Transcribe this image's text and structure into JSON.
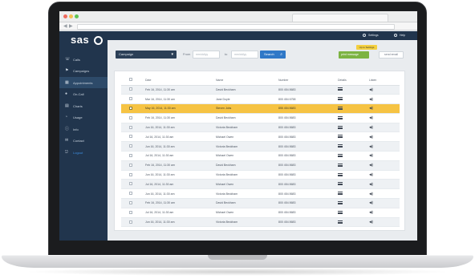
{
  "brand": {
    "logo_text": "sas"
  },
  "browser": {
    "url": ""
  },
  "sidebar": {
    "items": [
      {
        "label": "Calls",
        "icon": "phone-icon"
      },
      {
        "label": "Campaigns",
        "icon": "flag-icon"
      },
      {
        "label": "Appointments",
        "icon": "calendar-icon"
      },
      {
        "label": "On-Call",
        "icon": "users-icon"
      },
      {
        "label": "Charts",
        "icon": "chart-icon"
      },
      {
        "label": "Usage",
        "icon": "gauge-icon"
      },
      {
        "label": "Info",
        "icon": "info-icon"
      },
      {
        "label": "Contact",
        "icon": "chat-icon"
      },
      {
        "label": "Logout",
        "icon": "logout-icon"
      }
    ],
    "active_index": 2
  },
  "topbar": {
    "settings_label": "Settings",
    "help_label": "Help"
  },
  "toolbar": {
    "campaign_select": "Campaign",
    "from_label": "From",
    "from_placeholder": "mm/dd/yy",
    "to_label": "to",
    "to_placeholder": "mm/dd/yy",
    "search_label": "Search",
    "tooltip": "Up to Settings",
    "green_button": "print message",
    "plain_button": "send email"
  },
  "table": {
    "headers": [
      "",
      "Date",
      "Name",
      "Number",
      "Details",
      "Listen"
    ],
    "rows": [
      {
        "date": "Feb 16, 2014, 11:30 am",
        "name": "David Beckham",
        "number": "800 454 8683",
        "selected": false
      },
      {
        "date": "Mar 16, 2014, 11:30 am",
        "name": "Jane Doyle",
        "number": "800 454 6758",
        "selected": false
      },
      {
        "date": "May 16, 2014, 11:30 am",
        "name": "Steven Jobs",
        "number": "855 454 8683",
        "selected": true
      },
      {
        "date": "Feb 16, 2014, 11:30 am",
        "name": "David Beckham",
        "number": "800 454 8683",
        "selected": false
      },
      {
        "date": "Jun 16, 2014, 11:30 am",
        "name": "Victoria Beckham",
        "number": "800 454 8683",
        "selected": false
      },
      {
        "date": "Jul 16, 2014, 11:30 am",
        "name": "Michael Owen",
        "number": "800 454 8683",
        "selected": false
      },
      {
        "date": "Jun 16, 2014, 11:30 am",
        "name": "Victoria Beckham",
        "number": "800 454 8683",
        "selected": false
      },
      {
        "date": "Jul 16, 2014, 11:30 am",
        "name": "Michael Owen",
        "number": "800 454 8683",
        "selected": false
      },
      {
        "date": "Feb 16, 2014, 11:30 am",
        "name": "David Beckham",
        "number": "800 454 8683",
        "selected": false
      },
      {
        "date": "Jun 16, 2014, 11:30 am",
        "name": "Victoria Beckham",
        "number": "800 454 8683",
        "selected": false
      },
      {
        "date": "Jul 16, 2014, 11:30 am",
        "name": "Michael Owen",
        "number": "800 454 8683",
        "selected": false
      },
      {
        "date": "Jun 16, 2014, 11:30 am",
        "name": "Victoria Beckham",
        "number": "800 454 8683",
        "selected": false
      },
      {
        "date": "Feb 16, 2014, 11:30 am",
        "name": "David Beckham",
        "number": "800 454 8683",
        "selected": false
      },
      {
        "date": "Jul 16, 2014, 11:30 am",
        "name": "Michael Owen",
        "number": "800 454 8683",
        "selected": false
      },
      {
        "date": "Jun 16, 2014, 11:30 am",
        "name": "Victoria Beckham",
        "number": "800 454 8683",
        "selected": false
      }
    ]
  },
  "colors": {
    "sidebar": "#21354d",
    "accent": "#2f78c7",
    "selected_row": "#f6c343",
    "green": "#7cb342"
  }
}
